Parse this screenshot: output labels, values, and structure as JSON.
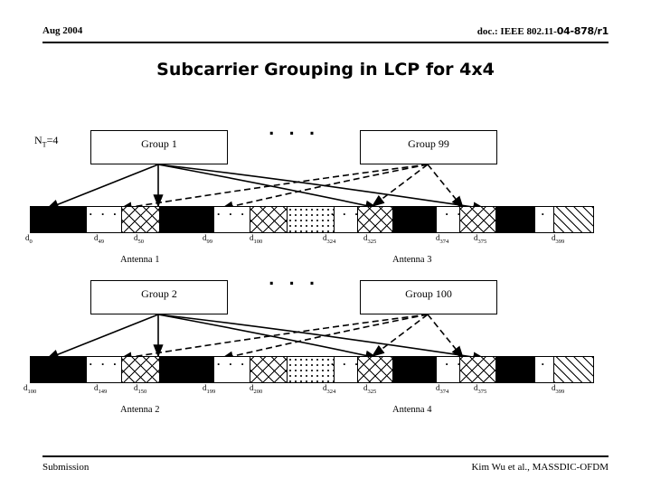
{
  "header": {
    "date": "Aug 2004",
    "doc_prefix": "doc.: IEEE 802.11-",
    "doc_number": "04-878/r1"
  },
  "title": "Subcarrier Grouping in LCP for 4x4",
  "nt_label": "N",
  "nt_sub": "T",
  "nt_value": "=4",
  "ellipsis": ". . .",
  "groups": {
    "group1": "Group 1",
    "group99": "Group 99",
    "group2": "Group 2",
    "group100": "Group 100"
  },
  "antennas": {
    "antenna1": "Antenna 1",
    "antenna2": "Antenna 2",
    "antenna3": "Antenna 3",
    "antenna4": "Antenna 4"
  },
  "row1": {
    "indices": [
      {
        "base": "d",
        "sub": "0"
      },
      {
        "base": "d",
        "sub": "49"
      },
      {
        "base": "d",
        "sub": "50"
      },
      {
        "base": "d",
        "sub": "99"
      },
      {
        "base": "d",
        "sub": "100"
      },
      {
        "base": "d",
        "sub": "324"
      },
      {
        "base": "d",
        "sub": "325"
      },
      {
        "base": "d",
        "sub": "374"
      },
      {
        "base": "d",
        "sub": "375"
      },
      {
        "base": "d",
        "sub": "399"
      }
    ],
    "segments": [
      {
        "fill": "black",
        "dots": ""
      },
      {
        "fill": "white",
        "dots": ". . ."
      },
      {
        "fill": "cross",
        "dots": ""
      },
      {
        "fill": "black",
        "dots": ""
      },
      {
        "fill": "white",
        "dots": ". . ."
      },
      {
        "fill": "cross",
        "dots": ""
      },
      {
        "fill": "dots",
        "dots": ""
      },
      {
        "fill": "white",
        "dots": ". . ."
      },
      {
        "fill": "cross",
        "dots": ""
      },
      {
        "fill": "black",
        "dots": ""
      },
      {
        "fill": "white",
        "dots": ". . ."
      },
      {
        "fill": "cross",
        "dots": ""
      },
      {
        "fill": "black",
        "dots": ""
      },
      {
        "fill": "white",
        "dots": ". . ."
      },
      {
        "fill": "diag",
        "dots": ""
      }
    ]
  },
  "row2": {
    "indices": [
      {
        "base": "d",
        "sub": "100"
      },
      {
        "base": "d",
        "sub": "149"
      },
      {
        "base": "d",
        "sub": "150"
      },
      {
        "base": "d",
        "sub": "199"
      },
      {
        "base": "d",
        "sub": "200"
      },
      {
        "base": "d",
        "sub": "324"
      },
      {
        "base": "d",
        "sub": "325"
      },
      {
        "base": "d",
        "sub": "374"
      },
      {
        "base": "d",
        "sub": "375"
      },
      {
        "base": "d",
        "sub": "399"
      }
    ],
    "segments": [
      {
        "fill": "black",
        "dots": ""
      },
      {
        "fill": "white",
        "dots": ". . ."
      },
      {
        "fill": "cross",
        "dots": ""
      },
      {
        "fill": "black",
        "dots": ""
      },
      {
        "fill": "white",
        "dots": ". . ."
      },
      {
        "fill": "cross",
        "dots": ""
      },
      {
        "fill": "dots",
        "dots": ""
      },
      {
        "fill": "white",
        "dots": ". . ."
      },
      {
        "fill": "cross",
        "dots": ""
      },
      {
        "fill": "black",
        "dots": ""
      },
      {
        "fill": "white",
        "dots": ". . ."
      },
      {
        "fill": "cross",
        "dots": ""
      },
      {
        "fill": "black",
        "dots": ""
      },
      {
        "fill": "white",
        "dots": ". . ."
      },
      {
        "fill": "diag",
        "dots": ""
      }
    ]
  },
  "footer": {
    "left": "Submission",
    "right": "Kim Wu et al., MASSDIC-OFDM"
  }
}
